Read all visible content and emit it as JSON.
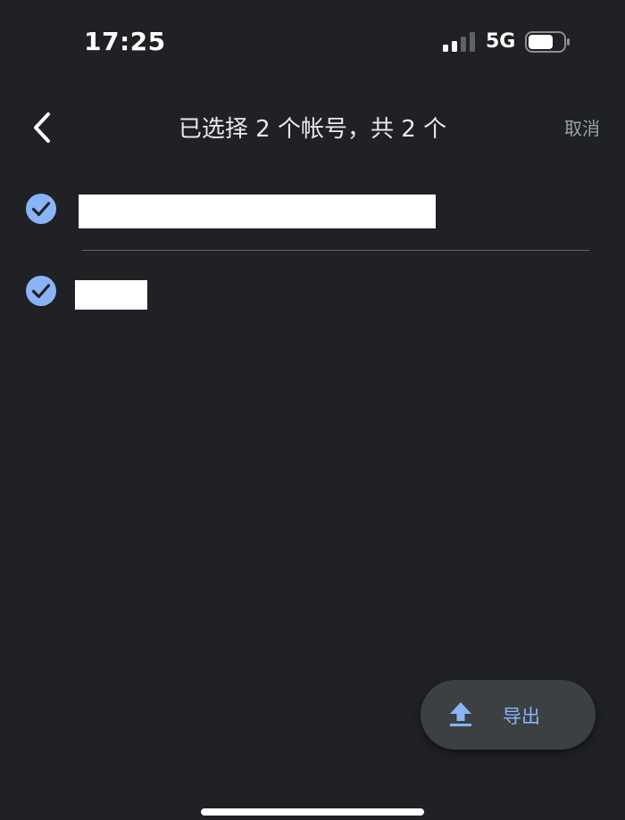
{
  "status_bar": {
    "time": "17:25",
    "network": "5G",
    "signal_icon": "signal-bars-icon",
    "battery_icon": "battery-icon"
  },
  "app_bar": {
    "back_icon": "chevron-left-icon",
    "title": "已选择 2 个帐号，共 2 个",
    "cancel_label": "取消"
  },
  "accounts": [
    {
      "name": "",
      "selected": true
    },
    {
      "name": "",
      "selected": true
    }
  ],
  "fab": {
    "icon": "upload-icon",
    "label": "导出"
  },
  "colors": {
    "background": "#202124",
    "accent": "#8ab4f8",
    "fab_background": "#3c4043",
    "divider": "#5f6368",
    "muted_text": "#9aa0a6"
  }
}
